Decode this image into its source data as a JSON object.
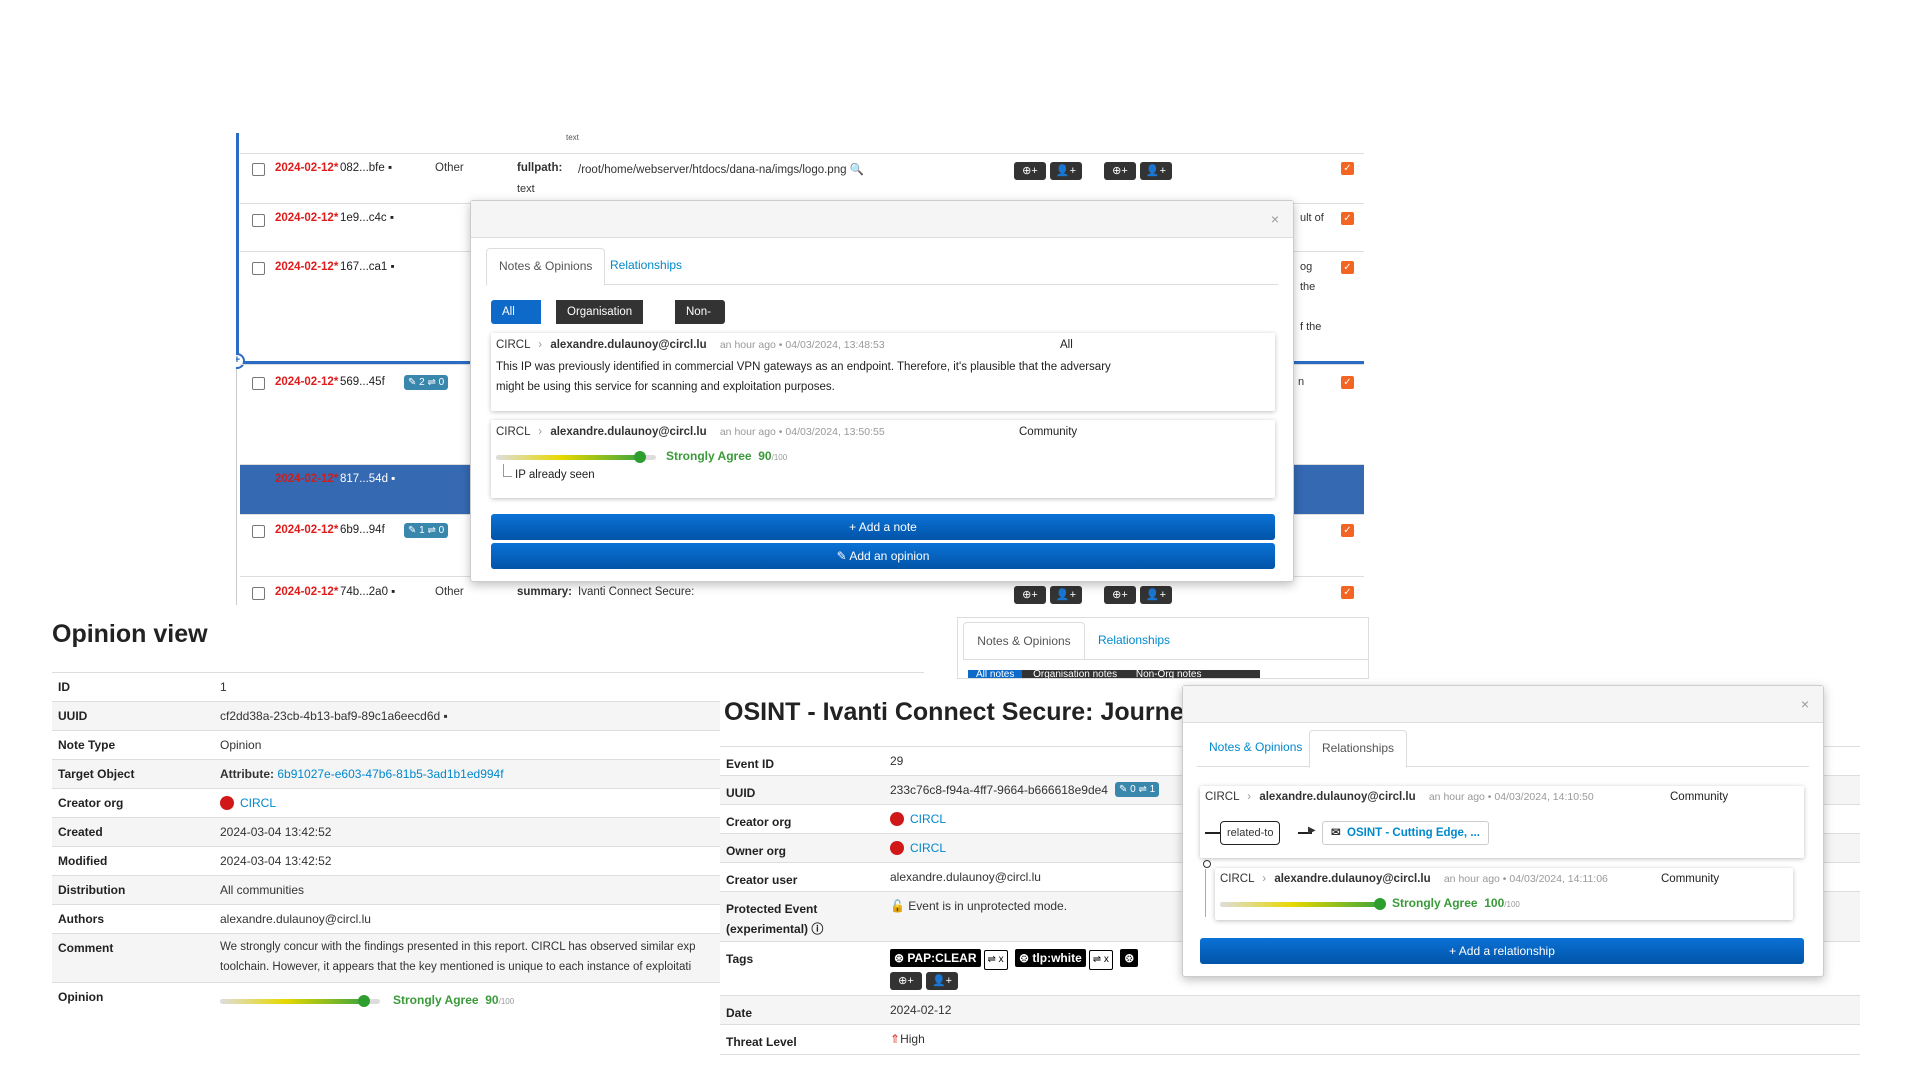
{
  "attributes": {
    "truncated_top": "text",
    "rows": [
      {
        "date": "2024-02-12*",
        "hash": "082...bfe",
        "category": "Other",
        "type": "fullpath:",
        "value": "/root/home/webserver/htdocs/dana-na/imgs/logo.png",
        "sub": "text"
      },
      {
        "date": "2024-02-12*",
        "hash": "1e9...c4c",
        "tail": "ult of"
      },
      {
        "date": "2024-02-12*",
        "hash": "167...ca1",
        "tail1": "og",
        "tail2": "the",
        "tail3": "f the"
      },
      {
        "date": "2024-02-12*",
        "hash": "569...45f",
        "badge_notes": "2",
        "badge_rel": "0",
        "tail": "n"
      },
      {
        "date": "2024-02-12*",
        "hash": "817...54d"
      },
      {
        "date": "2024-02-12*",
        "hash": "6b9...94f",
        "badge_notes": "1",
        "badge_rel": "0"
      },
      {
        "date": "2024-02-12*",
        "hash": "74b...2a0",
        "category": "Other",
        "type": "summary:",
        "value": "Ivanti Connect Secure:"
      }
    ],
    "tool_plus": "+"
  },
  "popover_notes": {
    "close": "×",
    "tabs": [
      "Notes & Opinions",
      "Relationships"
    ],
    "filters": [
      "All notes",
      "Organisation notes",
      "Non-Org notes"
    ],
    "notes": [
      {
        "org": "CIRCL",
        "sep": "›",
        "user": "alexandre.dulaunoy@circl.lu",
        "time": "an hour ago • 04/03/2024, 13:48:53",
        "scope": "All",
        "text": "This IP was previously identified in commercial VPN gateways as an endpoint. Therefore, it's plausible that the adversary might be using this service for scanning and exploitation purposes."
      },
      {
        "org": "CIRCL",
        "sep": "›",
        "user": "alexandre.dulaunoy@circl.lu",
        "time": "an hour ago • 04/03/2024, 13:50:55",
        "scope": "Community",
        "opinion_label": "Strongly Agree",
        "opinion_value": "90",
        "opinion_max": "/100",
        "opinion_level": 0.9,
        "comment": "IP already seen"
      }
    ],
    "add_note": "+ Add a note",
    "add_opinion": "✎ Add an opinion"
  },
  "opinion_view": {
    "title": "Opinion view",
    "rows": [
      {
        "k": "ID",
        "v": "1"
      },
      {
        "k": "UUID",
        "v": "cf2dd38a-23cb-4b13-baf9-89c1a6eecd6d"
      },
      {
        "k": "Note Type",
        "v": "Opinion"
      },
      {
        "k": "Target Object",
        "v_prefix": "Attribute:",
        "v_link": "6b91027e-e603-47b6-81b5-3ad1b1ed994f"
      },
      {
        "k": "Creator org",
        "v_link": "CIRCL"
      },
      {
        "k": "Created",
        "v": "2024-03-04 13:42:52"
      },
      {
        "k": "Modified",
        "v": "2024-03-04 13:42:52"
      },
      {
        "k": "Distribution",
        "v": "All communities"
      },
      {
        "k": "Authors",
        "v": "alexandre.dulaunoy@circl.lu"
      },
      {
        "k": "Comment",
        "v": "We strongly concur with the findings presented in this report. CIRCL has observed similar exp",
        "v2": "toolchain. However, it appears that the key mentioned is unique to each instance of exploitati"
      },
      {
        "k": "Opinion",
        "opinion_label": "Strongly Agree",
        "opinion_value": "90",
        "opinion_max": "/100",
        "opinion_level": 0.9
      }
    ]
  },
  "event_view": {
    "title": "OSINT - Ivanti Connect Secure: Journe",
    "rows": [
      {
        "k": "Event ID",
        "v": "29"
      },
      {
        "k": "UUID",
        "v": "233c76c8-f94a-4ff7-9664-b666618e9de4",
        "badge_notes": "0",
        "badge_rel": "1"
      },
      {
        "k": "Creator org",
        "v_link": "CIRCL"
      },
      {
        "k": "Owner org",
        "v_link": "CIRCL"
      },
      {
        "k": "Creator user",
        "v": "alexandre.dulaunoy@circl.lu"
      },
      {
        "k": "Protected Event",
        "k2": "(experimental)",
        "v": "Event is in unprotected mode."
      },
      {
        "k": "Tags",
        "tags": [
          "PAP:CLEAR",
          "tlp:white"
        ]
      },
      {
        "k": "Date",
        "v": "2024-02-12"
      },
      {
        "k": "Threat Level",
        "v": "High"
      }
    ]
  },
  "popover_rel_bg": {
    "tabs": [
      "Notes & Opinions",
      "Relationships"
    ],
    "filters": [
      "All notes",
      "Organisation notes",
      "Non-Org notes"
    ]
  },
  "popover_relationships": {
    "close": "×",
    "tabs": [
      "Notes & Opinions",
      "Relationships"
    ],
    "relationship": {
      "org": "CIRCL",
      "sep": "›",
      "user": "alexandre.dulaunoy@circl.lu",
      "time": "an hour ago • 04/03/2024, 14:10:50",
      "scope": "Community",
      "type": "related-to",
      "target": "OSINT - Cutting Edge, ..."
    },
    "opinion": {
      "org": "CIRCL",
      "sep": "›",
      "user": "alexandre.dulaunoy@circl.lu",
      "time": "an hour ago • 04/03/2024, 14:11:06",
      "scope": "Community",
      "label": "Strongly Agree",
      "value": "100",
      "max": "/100",
      "level": 1.0
    },
    "add_relationship": "+ Add a relationship"
  },
  "colors": {
    "accent": "#0e6ac9",
    "agree": "#3a9a3a",
    "date_red": "#e01b1b",
    "selected_row": "#3569b2",
    "checkbox_orange": "#f26522"
  }
}
